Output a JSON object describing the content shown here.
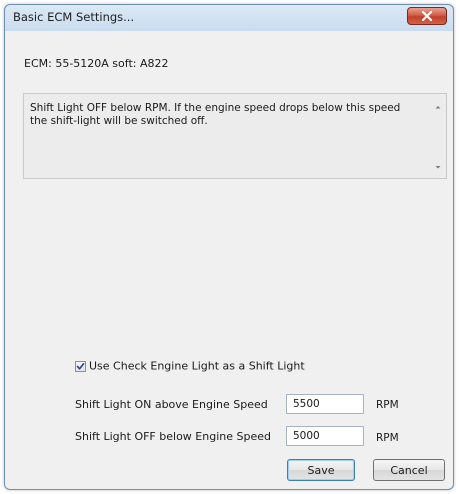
{
  "window": {
    "title": "Basic ECM Settings..."
  },
  "ecm_info": "ECM: 55-5120A soft: A822",
  "description": "Shift Light OFF below RPM. If the engine speed drops below this speed the shift-light will be switched off.",
  "checkbox": {
    "label": "Use Check Engine Light as a Shift Light",
    "checked": true
  },
  "fields": [
    {
      "label": "Shift Light ON above Engine Speed",
      "value": "5500",
      "unit": "RPM"
    },
    {
      "label": "Shift Light OFF below Engine Speed",
      "value": "5000",
      "unit": "RPM"
    }
  ],
  "buttons": {
    "save": "Save",
    "cancel": "Cancel"
  },
  "colors": {
    "close_button": "#c8472f",
    "window_border": "#6f8fb3",
    "default_button_border": "#3c7fb1"
  },
  "icons": {
    "close": "close-icon",
    "check": "check-icon",
    "scroll_up": "scroll-up-icon",
    "scroll_down": "scroll-down-icon"
  }
}
